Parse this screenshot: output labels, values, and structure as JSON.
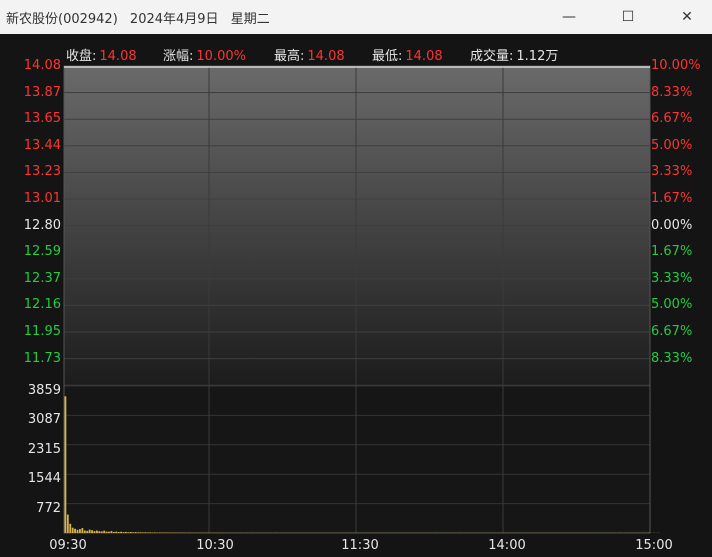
{
  "window": {
    "stock_name": "新农股份(002942)",
    "date": "2024年4月9日",
    "weekday": "星期二",
    "minimize_glyph": "—",
    "maximize_glyph": "☐",
    "close_glyph": "✕"
  },
  "info": {
    "close_label": "收盘:",
    "close_value": "14.08",
    "change_label": "涨幅:",
    "change_value": "10.00%",
    "high_label": "最高:",
    "high_value": "14.08",
    "low_label": "最低:",
    "low_value": "14.08",
    "volume_label": "成交量:",
    "volume_value": "1.12万"
  },
  "colors": {
    "up": "#ff3333",
    "down": "#22cc44",
    "neutral": "#e6e6e6",
    "volume_bar": "#d6b24a"
  },
  "chart_data": [
    {
      "type": "line",
      "title": "",
      "price_ticks": [
        "14.08",
        "13.87",
        "13.65",
        "13.44",
        "13.23",
        "13.01",
        "12.80",
        "12.59",
        "12.37",
        "12.16",
        "11.95",
        "11.73"
      ],
      "percent_ticks": [
        "10.00%",
        "8.33%",
        "6.67%",
        "5.00%",
        "3.33%",
        "1.67%",
        "0.00%",
        "1.67%",
        "3.33%",
        "5.00%",
        "6.67%",
        "8.33%"
      ],
      "ylim": [
        11.52,
        14.08
      ],
      "reference_price": 12.8,
      "series": [
        {
          "values": [
            14.08,
            14.08
          ]
        }
      ],
      "x_ticks": [
        "09:30",
        "10:30",
        "11:30",
        "14:00",
        "15:00"
      ],
      "grid": true
    },
    {
      "type": "bar",
      "volume_ticks": [
        "3859",
        "3087",
        "2315",
        "1544",
        "772"
      ],
      "ylim": [
        0,
        4150
      ],
      "values": [
        3859,
        520,
        260,
        150,
        120,
        90,
        110,
        140,
        70,
        60,
        95,
        80,
        55,
        70,
        50,
        45,
        65,
        40,
        35,
        55,
        30,
        40,
        28,
        35,
        25,
        30,
        22,
        28,
        20,
        25,
        18,
        22,
        16,
        20,
        15,
        18,
        14,
        16,
        12,
        15,
        12,
        14,
        10,
        13,
        10,
        12,
        9,
        11,
        9,
        10,
        8,
        10,
        8,
        9,
        7,
        9,
        7,
        8,
        6,
        8,
        6,
        7,
        6,
        7,
        5,
        7,
        5,
        6,
        5,
        6,
        5,
        6,
        5,
        6,
        4,
        6,
        4,
        5,
        4,
        5,
        4,
        5,
        4,
        5,
        4,
        5,
        4,
        5,
        4,
        5,
        4,
        5,
        4,
        5,
        4,
        5,
        4,
        5,
        4,
        5,
        4,
        5,
        4,
        5,
        4,
        5,
        4,
        5,
        4,
        5,
        4,
        5,
        4,
        5,
        4,
        5,
        4,
        5,
        4,
        5,
        4,
        5,
        4,
        5,
        4,
        5,
        4,
        5,
        4,
        5,
        4,
        5,
        4,
        5,
        4,
        5,
        4,
        5,
        4,
        5,
        4,
        5,
        4,
        5,
        4,
        5,
        4,
        5,
        4,
        5,
        4,
        5,
        4,
        5,
        4,
        5,
        4,
        5,
        4,
        5,
        4,
        5,
        4,
        5,
        4,
        5,
        4,
        5,
        4,
        5,
        4,
        5,
        4,
        5,
        4,
        5,
        4,
        5,
        4,
        5,
        4,
        5,
        4,
        5,
        4,
        5,
        4,
        5,
        4,
        5,
        4,
        5,
        4,
        5,
        4,
        5,
        4,
        5,
        4,
        5,
        4,
        5,
        4,
        5,
        4,
        5,
        4,
        5,
        4,
        5,
        4,
        5,
        4,
        5,
        4,
        5,
        4,
        5,
        4,
        5,
        4,
        5,
        4,
        5,
        4,
        5,
        4,
        5,
        4,
        5,
        4,
        5,
        4,
        5,
        4,
        5,
        4,
        5,
        4,
        5,
        4,
        5,
        4,
        5,
        4,
        5
      ]
    }
  ]
}
